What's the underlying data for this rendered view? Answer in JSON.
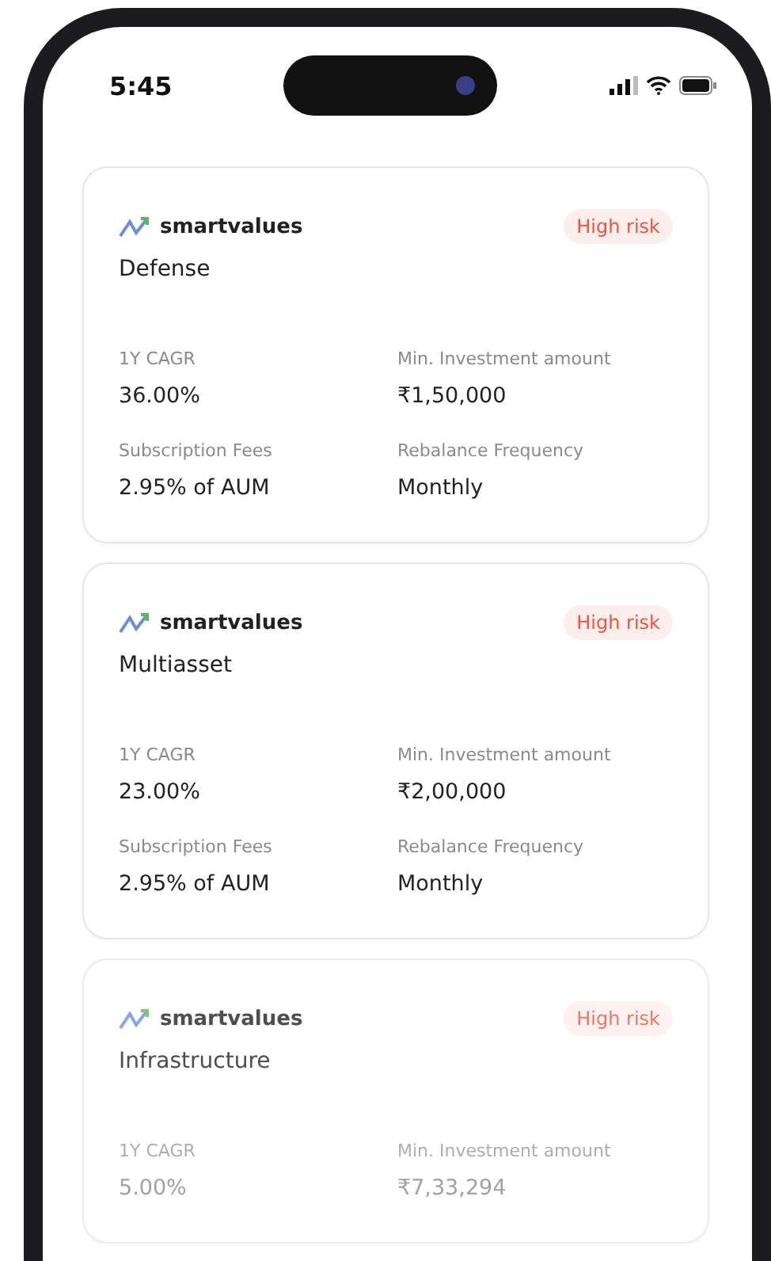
{
  "status_bar": {
    "time": "5:45"
  },
  "cards": [
    {
      "brand": "smartvalues",
      "risk": "High risk",
      "title": "Defense",
      "faded": false,
      "stats": [
        {
          "label": "1Y CAGR",
          "value": "36.00%"
        },
        {
          "label": "Min. Investment amount",
          "value": "₹1,50,000"
        },
        {
          "label": "Subscription Fees",
          "value": "2.95% of AUM"
        },
        {
          "label": "Rebalance Frequency",
          "value": "Monthly"
        }
      ]
    },
    {
      "brand": "smartvalues",
      "risk": "High risk",
      "title": "Multiasset",
      "faded": false,
      "stats": [
        {
          "label": "1Y CAGR",
          "value": "23.00%"
        },
        {
          "label": "Min. Investment amount",
          "value": "₹2,00,000"
        },
        {
          "label": "Subscription Fees",
          "value": "2.95% of AUM"
        },
        {
          "label": "Rebalance Frequency",
          "value": "Monthly"
        }
      ]
    },
    {
      "brand": "smartvalues",
      "risk": "High risk",
      "title": "Infrastructure",
      "faded": true,
      "stats": [
        {
          "label": "1Y CAGR",
          "value": "5.00%"
        },
        {
          "label": "Min. Investment amount",
          "value": "₹7,33,294"
        }
      ]
    }
  ]
}
